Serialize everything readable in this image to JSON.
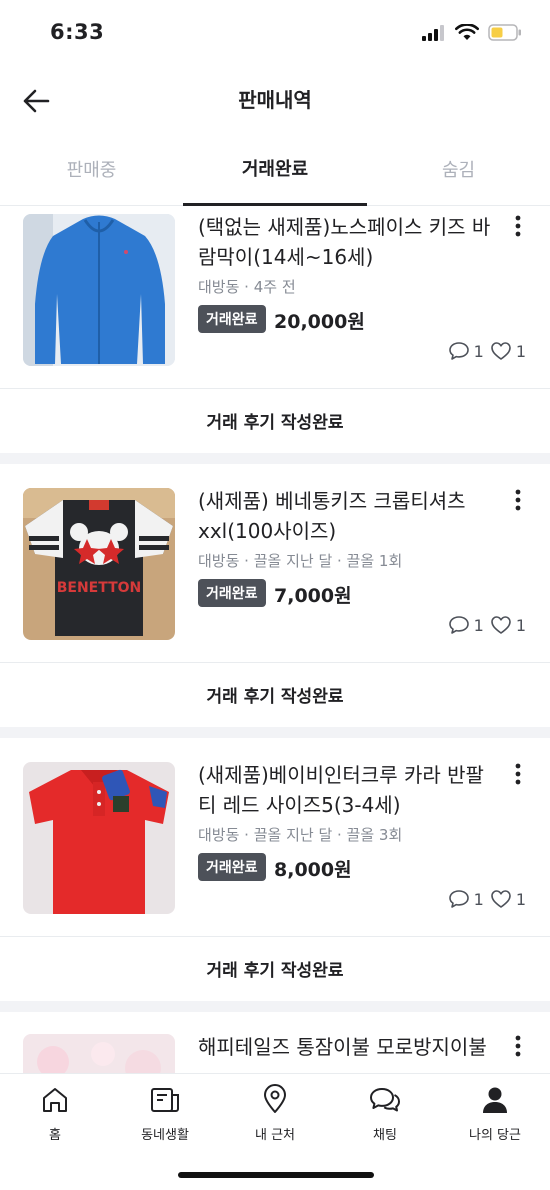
{
  "status_bar": {
    "time": "6:33",
    "battery_color": "#f7ce45"
  },
  "header": {
    "title": "판매내역",
    "back_icon": "arrow-left-icon"
  },
  "tabs": [
    {
      "label": "판매중",
      "active": false
    },
    {
      "label": "거래완료",
      "active": true
    },
    {
      "label": "숨김",
      "active": false
    }
  ],
  "items": [
    {
      "title": "(택없는 새제품)노스페이스 키즈 바람막이(14세~16세)",
      "meta": "대방동 · 4주 전",
      "badge": "거래완료",
      "price": "20,000원",
      "chat_count": "1",
      "like_count": "1",
      "review": "거래 후기 작성완료"
    },
    {
      "title": "(새제품) 베네통키즈 크롭티셔츠 xxl(100사이즈)",
      "meta": "대방동 · 끌올 지난 달 · 끌올 1회",
      "badge": "거래완료",
      "price": "7,000원",
      "chat_count": "1",
      "like_count": "1",
      "review": "거래 후기 작성완료"
    },
    {
      "title": "(새제품)베이비인터크루 카라 반팔티 레드 사이즈5(3-4세)",
      "meta": "대방동 · 끌올 지난 달 · 끌올 3회",
      "badge": "거래완료",
      "price": "8,000원",
      "chat_count": "1",
      "like_count": "1",
      "review": "거래 후기 작성완료"
    },
    {
      "title": "해피테일즈 통잠이불 모로방지이불"
    }
  ],
  "bottom_nav": [
    {
      "label": "홈",
      "icon": "home-icon"
    },
    {
      "label": "동네생활",
      "icon": "neighborhood-icon"
    },
    {
      "label": "내 근처",
      "icon": "location-pin-icon"
    },
    {
      "label": "채팅",
      "icon": "chat-icon"
    },
    {
      "label": "나의 당근",
      "icon": "profile-icon"
    }
  ],
  "colors": {
    "accent_text": "#212124",
    "muted_text": "#868b94",
    "badge_bg": "#4d5159",
    "divider": "#e9ecef"
  }
}
